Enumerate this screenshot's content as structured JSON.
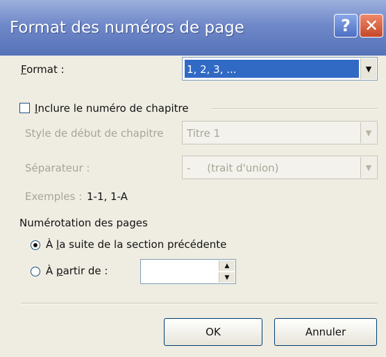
{
  "window": {
    "title": "Format des numéros de page",
    "help_icon": "?",
    "close_icon": "✕"
  },
  "format": {
    "label": "Format :",
    "label_accel": "F",
    "label_rest": "ormat :",
    "value": "1, 2, 3, ..."
  },
  "chapter": {
    "checkbox_accel": "I",
    "checkbox_rest": "nclure le numéro de chapitre",
    "checked": false,
    "style_label": "Style de début de chapitre",
    "style_value": "Titre 1",
    "separator_label": "Séparateur :",
    "separator_value": "-     (trait d'union)",
    "examples_label": "Exemples :",
    "examples_value": "1-1, 1-A"
  },
  "numbering": {
    "group_label": "Numérotation des pages",
    "option1_prefix": "À ",
    "option1_accel": "l",
    "option1_rest": "a suite de la section précédente",
    "option1_checked": true,
    "option2_prefix": "À ",
    "option2_accel": "p",
    "option2_rest": "artir de :",
    "option2_checked": false,
    "start_value": ""
  },
  "buttons": {
    "ok": "OK",
    "cancel": "Annuler"
  },
  "colors": {
    "titlebar": "#6f88c8",
    "dialog_bg": "#efede2",
    "selection": "#316ac5"
  }
}
